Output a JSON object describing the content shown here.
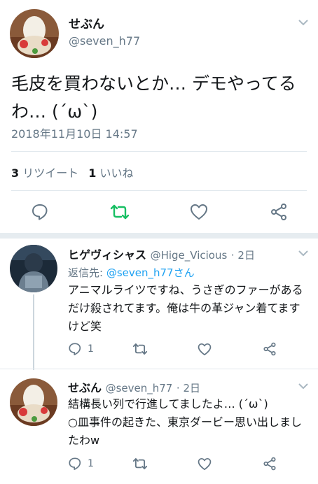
{
  "main_tweet": {
    "display_name": "せぶん",
    "handle": "@seven_h77",
    "text": "毛皮を買わないとか… デモやってるわ… (´ω`)",
    "timestamp": "2018年11月10日 14:57",
    "retweet_count": "3",
    "retweet_label": "リツイート",
    "like_count": "1",
    "like_label": "いいね"
  },
  "replies": [
    {
      "display_name": "ヒゲヴィシャス",
      "handle": "@Hige_Vicious",
      "age": "· 2日",
      "reply_prefix": "返信先:",
      "reply_to": "@seven_h77さん",
      "text": "アニマルライツですね、うさぎのファーがあるだけ殺されてます。俺は牛の革ジャン着てますけど笑",
      "reply_count": "1"
    },
    {
      "display_name": "せぶん",
      "handle": "@seven_h77",
      "age": "· 2日",
      "text": "結構長い列で行進してましたよ… (´ω`)\n○皿事件の起きた、東京ダービー思い出しましたわw",
      "reply_count": "1"
    }
  ],
  "colors": {
    "accent": "#1da1f2",
    "retweet_green": "#17bf63",
    "secondary_text": "#657786",
    "border": "#e1e8ed"
  }
}
